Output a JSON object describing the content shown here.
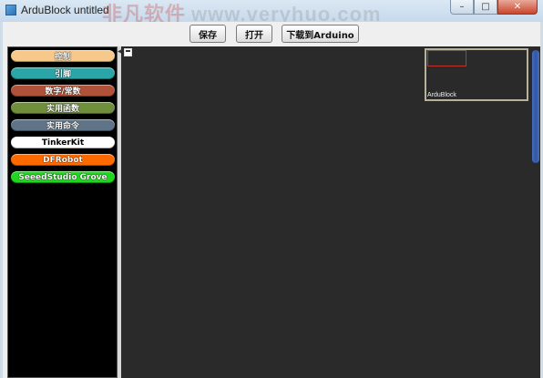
{
  "window": {
    "title": "ArduBlock untitled",
    "watermark": "www.veryhuo.com",
    "watermark_logo": "非凡软件",
    "minimize_symbol": "–",
    "maximize_symbol": "□",
    "close_symbol": "✕"
  },
  "toolbar": {
    "save_label": "保存",
    "open_label": "打开",
    "upload_label": "下载到Arduino"
  },
  "palette": {
    "categories": [
      {
        "label": "控制",
        "color": "#f6c98a"
      },
      {
        "label": "引脚",
        "color": "#2aa6a8"
      },
      {
        "label": "数字/常数",
        "color": "#b0523a"
      },
      {
        "label": "实用函数",
        "color": "#6f8f3c"
      },
      {
        "label": "实用命令",
        "color": "#5f7486"
      },
      {
        "label": "TinkerKit",
        "color": "#ffffff"
      },
      {
        "label": "DFRobot",
        "color": "#ff6a00"
      },
      {
        "label": "SeeedStudio Grove",
        "color": "#1ed81e"
      }
    ]
  },
  "workspace": {
    "minimap_label": "ArduBlock",
    "background": "#2a2a2a"
  },
  "colors": {
    "accent_scroll": "#2f56a8",
    "minimap_viewport": "#c0322b"
  }
}
